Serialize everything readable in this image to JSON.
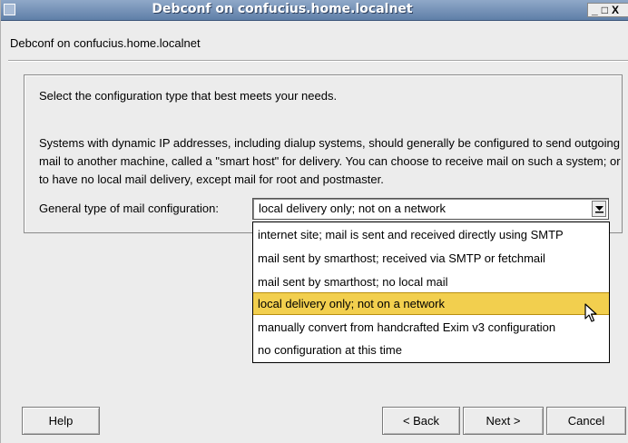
{
  "window": {
    "title": "Debconf on confucius.home.localnet",
    "controls": {
      "minimize": "_",
      "maximize": "□",
      "close": "X"
    }
  },
  "subtitle": "Debconf on confucius.home.localnet",
  "question": {
    "intro": "Select the configuration type that best meets your needs.",
    "description": "Systems with dynamic IP addresses, including dialup systems, should generally be configured to send outgoing mail to another machine, called a \"smart host\" for delivery. You can choose to receive mail on such a system; or to have no local mail delivery, except mail for root and postmaster."
  },
  "field": {
    "label": "General type of mail configuration:",
    "value": "local delivery only; not on a network"
  },
  "options": [
    {
      "label": "internet site; mail is sent and received directly using SMTP"
    },
    {
      "label": "mail sent by smarthost; received via SMTP or fetchmail"
    },
    {
      "label": "mail sent by smarthost; no local mail"
    },
    {
      "label": "local delivery only; not on a network"
    },
    {
      "label": "manually convert from handcrafted Exim v3 configuration"
    },
    {
      "label": "no configuration at this time"
    }
  ],
  "selected_option_index": 3,
  "buttons": {
    "help": "Help",
    "back": "< Back",
    "next": "Next >",
    "cancel": "Cancel"
  },
  "colors": {
    "titlebar": "#5f7fa8",
    "highlight": "#f2cf4e"
  }
}
